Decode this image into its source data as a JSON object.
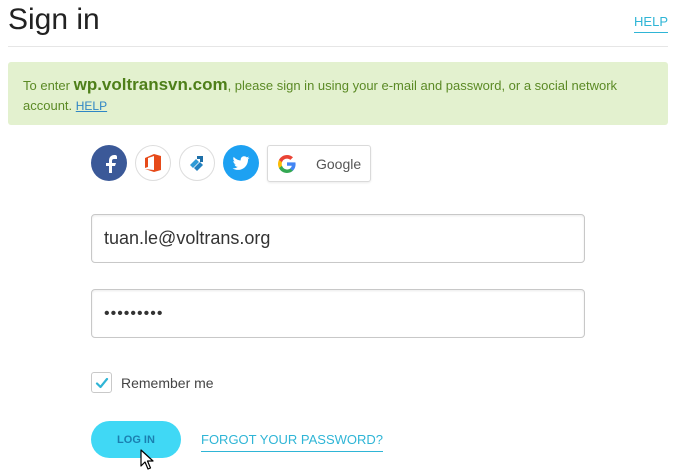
{
  "header": {
    "title": "Sign in",
    "help_label": "HELP"
  },
  "notice": {
    "prefix": "To enter ",
    "domain": "wp.voltransvn.com",
    "suffix": ", please sign in using your e-mail and password, or a social network account. ",
    "help_link": "HELP"
  },
  "social": {
    "buttons": [
      {
        "name": "facebook",
        "icon": "facebook-icon",
        "color": "#3b5998"
      },
      {
        "name": "office",
        "icon": "office-icon",
        "color": "#e64a19"
      },
      {
        "name": "trello",
        "icon": "trello-icon",
        "color": "#1e6fa8"
      },
      {
        "name": "twitter",
        "icon": "twitter-icon",
        "color": "#1da1f2"
      }
    ],
    "google_label": "Google"
  },
  "form": {
    "email_value": "tuan.le@voltrans.org",
    "password_value": "•••••••••",
    "remember_label": "Remember me",
    "remember_checked": true,
    "login_label": "LOG IN",
    "forgot_label": "FORGOT YOUR PASSWORD?"
  },
  "colors": {
    "accent": "#2fb5d6",
    "button": "#40d8f5",
    "notice_bg": "#e3f1cf",
    "notice_text": "#5b8a25"
  }
}
